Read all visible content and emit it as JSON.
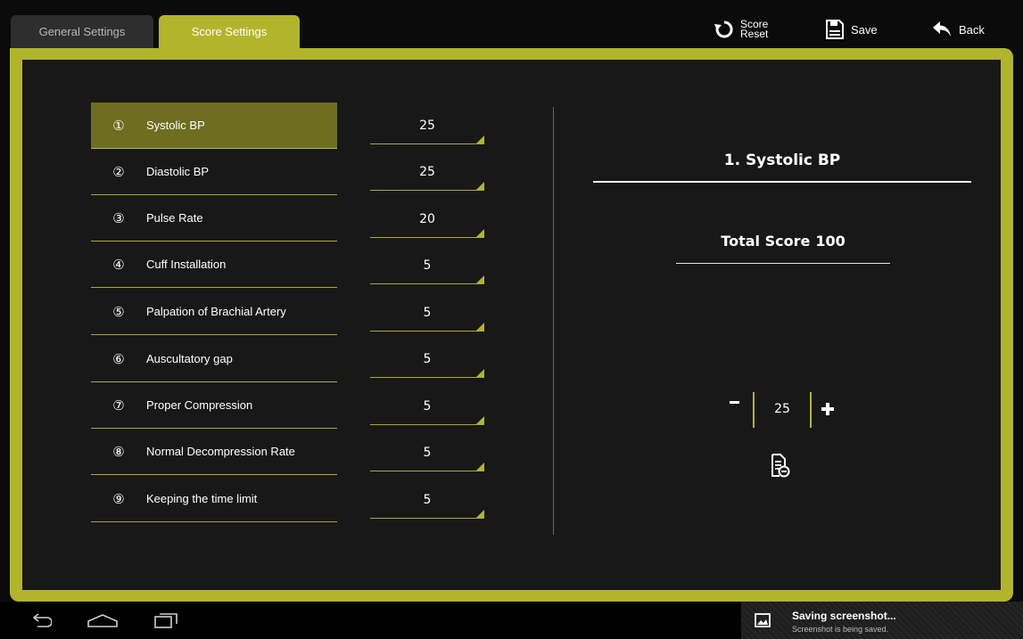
{
  "tabs": [
    {
      "label": "General Settings",
      "active": false
    },
    {
      "label": "Score Settings",
      "active": true
    }
  ],
  "toolbar": {
    "score_reset_line1": "Score",
    "score_reset_line2": "Reset",
    "save_label": "Save",
    "back_label": "Back",
    "icons": [
      "reset-icon",
      "save-icon",
      "back-icon"
    ]
  },
  "score_items": [
    {
      "num": "①",
      "label": "Systolic BP",
      "score": "25"
    },
    {
      "num": "②",
      "label": "Diastolic BP",
      "score": "25"
    },
    {
      "num": "③",
      "label": "Pulse Rate",
      "score": "20"
    },
    {
      "num": "④",
      "label": "Cuff Installation",
      "score": "5"
    },
    {
      "num": "⑤",
      "label": "Palpation of Brachial Artery",
      "score": "5"
    },
    {
      "num": "⑥",
      "label": "Auscultatory gap",
      "score": "5"
    },
    {
      "num": "⑦",
      "label": "Proper Compression",
      "score": "5"
    },
    {
      "num": "⑧",
      "label": "Normal Decompression Rate",
      "score": "5"
    },
    {
      "num": "⑨",
      "label": "Keeping the time limit",
      "score": "5"
    }
  ],
  "selected_index": 0,
  "detail": {
    "title": "1. Systolic BP",
    "total_label": "Total Score",
    "total_value": "100",
    "stepper_value": "25"
  },
  "notification": {
    "title": "Saving screenshot...",
    "subtitle": "Screenshot is being saved."
  },
  "colors": {
    "accent": "#b1b52c",
    "selected_row": "#6d6e1f",
    "panel": "#181818",
    "background": "#0b0b0b"
  }
}
